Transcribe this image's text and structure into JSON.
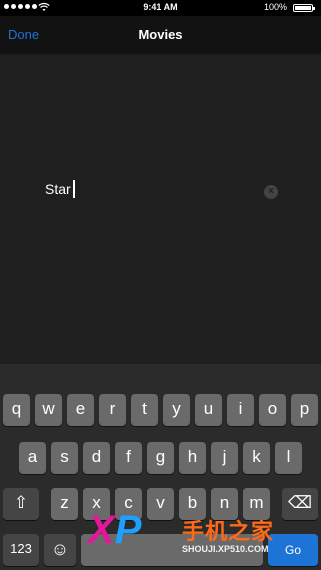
{
  "status_bar": {
    "time": "9:41 AM",
    "battery_label": "100%",
    "battery_level": 1.0,
    "signal_icon": "signal-dots-icon",
    "wifi_icon": "wifi-icon"
  },
  "nav": {
    "done_label": "Done",
    "title": "Movies"
  },
  "search": {
    "value": "Star",
    "clear_icon": "clear-circle-icon"
  },
  "keyboard": {
    "row1": [
      "q",
      "w",
      "e",
      "r",
      "t",
      "y",
      "u",
      "i",
      "o",
      "p"
    ],
    "row2": [
      "a",
      "s",
      "d",
      "f",
      "g",
      "h",
      "j",
      "k",
      "l"
    ],
    "row3": [
      "z",
      "x",
      "c",
      "v",
      "b",
      "n",
      "m"
    ],
    "shift_glyph": "⇧",
    "delete_glyph": "⌫",
    "numbers_label": "123",
    "emoji_glyph": "☺",
    "return_label": "Go",
    "accent_color": "#1e74d6"
  },
  "watermark": {
    "logo_x": "X",
    "logo_p": "P",
    "chinese": "手机之家",
    "url": "SHOUJI.XP510.COM"
  }
}
